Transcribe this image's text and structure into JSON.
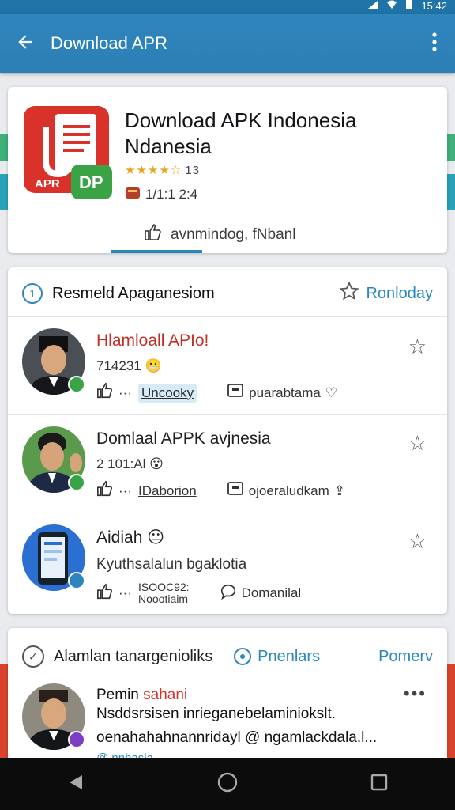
{
  "status_bar": {
    "time": "15:42"
  },
  "app_bar": {
    "title": "Download APR",
    "back_icon": "arrow-left-icon",
    "menu_icon": "more-vert-icon"
  },
  "app_header": {
    "icon_text_left": "APR",
    "icon_text_right": "DP",
    "title_line1": "Download APK Indonesia",
    "title_line2": "Ndanesia",
    "stars": "★★★★☆",
    "rating_num": "13",
    "size": "1/1:1 2:4",
    "download_label": "avnmindog, fNbanl"
  },
  "list_section": {
    "title": "Resmeld Apaganesiom",
    "number_icon": "1",
    "action_label": "Ronloday",
    "items": [
      {
        "title": "Hlamloall APIo!",
        "title_color": "#c0302a",
        "subtitle": "714231",
        "chip": "Uncooky",
        "share_label": "puarabtama"
      },
      {
        "title": "Domlaal APPK avjnesia",
        "title_color": "#111111",
        "subtitle": "2 101:Al",
        "chip": "IDaborion",
        "share_label": "ojoeraludkam"
      },
      {
        "title": "Aidiah",
        "title_color": "#111111",
        "subtitle": "Kyuthsalalun bgaklotia",
        "chip": "ISOOC92:\nNoootiaim",
        "share_label": "Domanilal"
      }
    ]
  },
  "bottom_section": {
    "title": "Alamlan tanargenioliks",
    "mid_label": "Pnenlars",
    "right_label": "Pomerv",
    "author_prefix": "Pemin",
    "author_name": "sahani",
    "line1": "Nsddsrsisen inrieganebelaminiokslt.",
    "line2": "oenahahahnannridayl @ ngamlackdala.l...",
    "line3": "@ nnhasla"
  },
  "colors": {
    "brand": "#2b86c0",
    "appbar": "#2f86bd",
    "navbar": "#0c0c0c"
  }
}
